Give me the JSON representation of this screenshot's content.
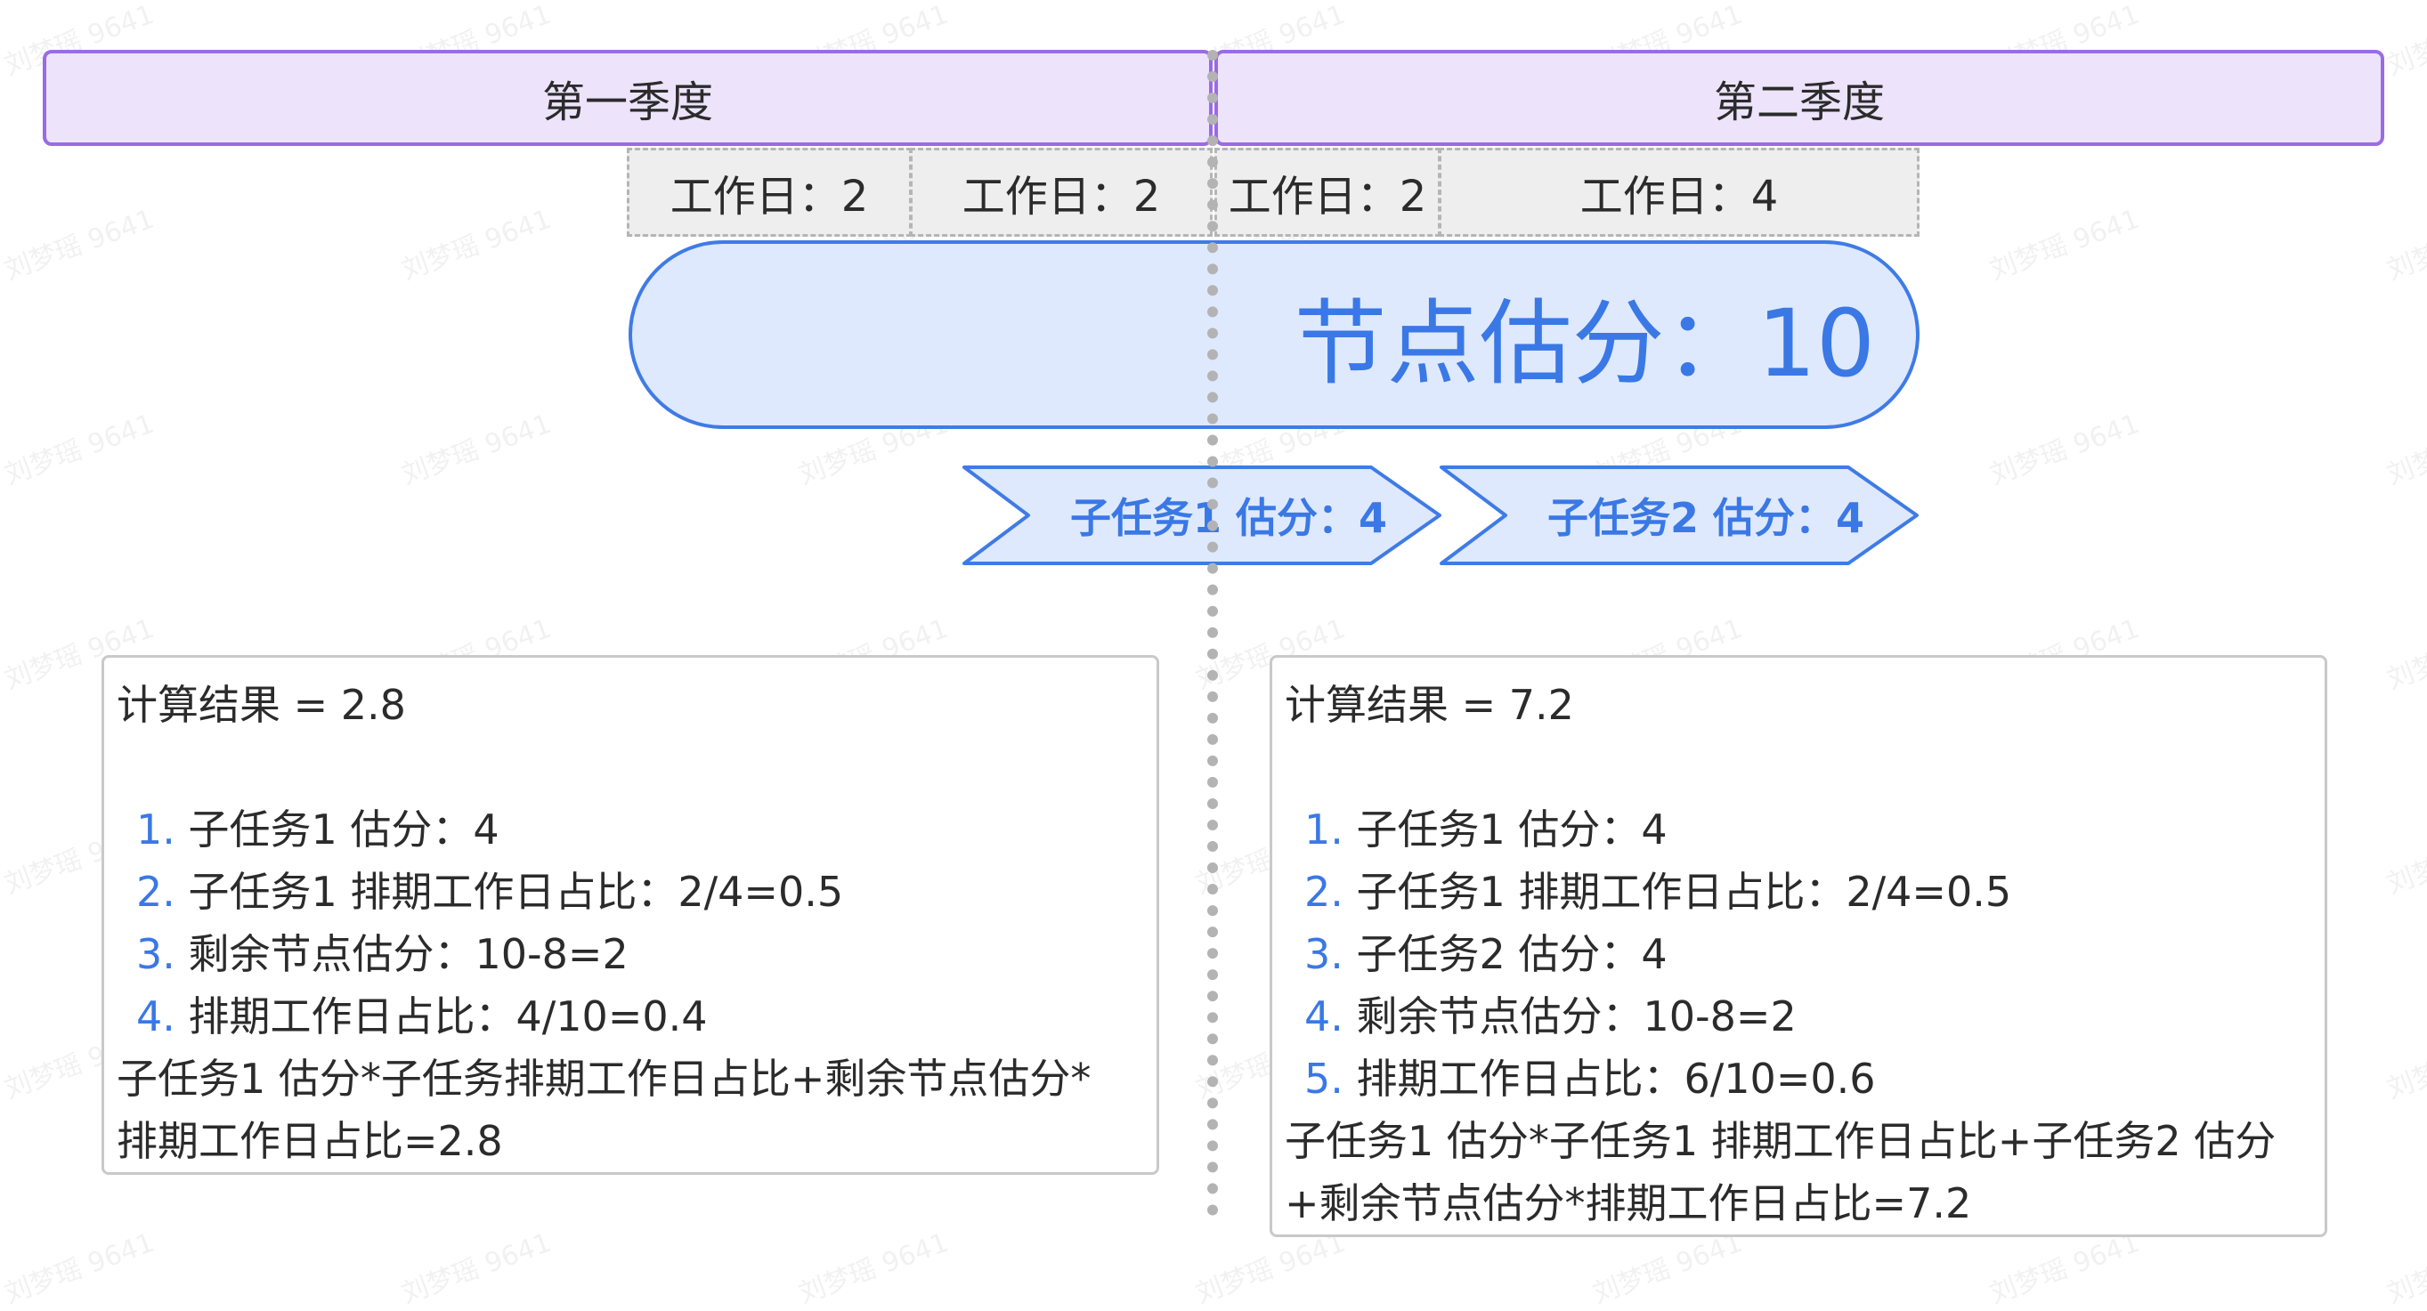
{
  "quarters": [
    {
      "label": "第一季度"
    },
    {
      "label": "第二季度"
    }
  ],
  "workdays": [
    {
      "label": "工作日：2"
    },
    {
      "label": "工作日：2"
    },
    {
      "label": "工作日：2"
    },
    {
      "label": "工作日：4"
    }
  ],
  "node": {
    "label": "节点估分：10"
  },
  "subtasks": [
    {
      "label": "子任务1 估分：4"
    },
    {
      "label": "子任务2 估分：4"
    }
  ],
  "results": [
    {
      "title": "计算结果 = 2.8",
      "items": [
        {
          "num": "1.",
          "text": "子任务1 估分：4"
        },
        {
          "num": "2.",
          "text": "子任务1 排期工作日占比：2/4=0.5"
        },
        {
          "num": "3.",
          "text": "剩余节点估分：10-8=2"
        },
        {
          "num": "4.",
          "text": "排期工作日占比：4/10=0.4"
        }
      ],
      "formula_line1": "子任务1 估分*子任务排期工作日占比+剩余节点估分*",
      "formula_line2": "排期工作日占比=2.8"
    },
    {
      "title": "计算结果 = 7.2",
      "items": [
        {
          "num": "1.",
          "text": "子任务1 估分：4"
        },
        {
          "num": "2.",
          "text": "子任务1 排期工作日占比：2/4=0.5"
        },
        {
          "num": "3.",
          "text": "子任务2 估分：4"
        },
        {
          "num": "4.",
          "text": "剩余节点估分：10-8=2"
        },
        {
          "num": "5.",
          "text": "排期工作日占比：6/10=0.6"
        }
      ],
      "formula_line1": "子任务1 估分*子任务1 排期工作日占比+子任务2 估分",
      "formula_line2": "+剩余节点估分*排期工作日占比=7.2"
    }
  ],
  "watermark": "刘梦瑶 9641",
  "colors": {
    "quarter_fill": "#ede4fb",
    "quarter_border": "#9a6be6",
    "node_fill": "#dfe9fd",
    "accent_blue": "#3a78e6",
    "workday_fill": "#eeeeee",
    "divider": "#b3b3b3"
  }
}
